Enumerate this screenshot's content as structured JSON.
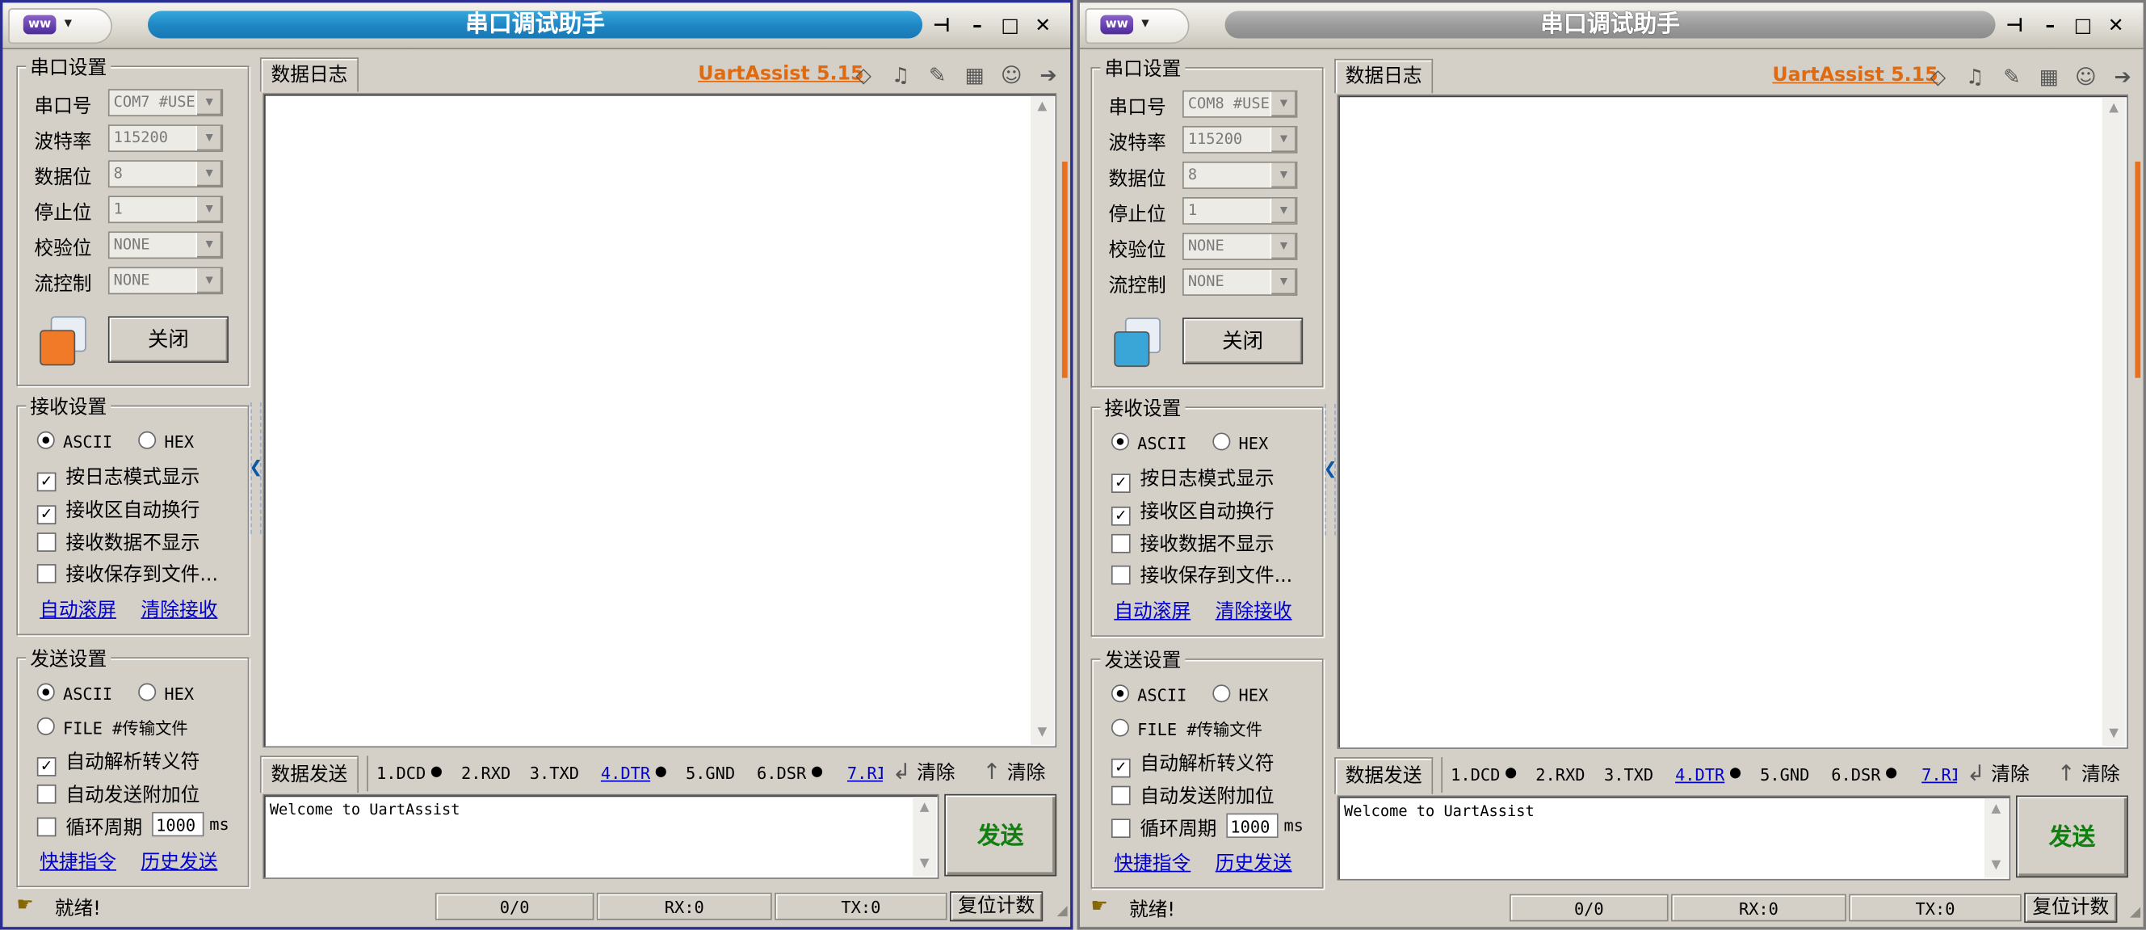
{
  "windows": [
    {
      "id": "left",
      "title": "串口调试助手",
      "serial": {
        "legend": "串口设置",
        "fields": [
          {
            "label": "串口号",
            "value": "COM7 #USE"
          },
          {
            "label": "波特率",
            "value": "115200"
          },
          {
            "label": "数据位",
            "value": "8"
          },
          {
            "label": "停止位",
            "value": "1"
          },
          {
            "label": "校验位",
            "value": "NONE"
          },
          {
            "label": "流控制",
            "value": "NONE"
          }
        ],
        "port_icon_color": "#f07a28",
        "open_close_label": "关闭"
      },
      "receive": {
        "legend": "接收设置",
        "ascii": "ASCII",
        "hex": "HEX",
        "options": [
          {
            "label": "按日志模式显示",
            "checked": true
          },
          {
            "label": "接收区自动换行",
            "checked": true
          },
          {
            "label": "接收数据不显示",
            "checked": false
          },
          {
            "label": "接收保存到文件...",
            "checked": false
          }
        ],
        "link_autoscroll": "自动滚屏",
        "link_clear": "清除接收"
      },
      "send": {
        "legend": "发送设置",
        "ascii": "ASCII",
        "hex": "HEX",
        "file": "FILE #传输文件",
        "options": [
          {
            "label": "自动解析转义符",
            "checked": true
          },
          {
            "label": "自动发送附加位",
            "checked": false
          }
        ],
        "cycle_label": "循环周期",
        "cycle_value": "1000",
        "cycle_unit": "ms",
        "link_shortcut": "快捷指令",
        "link_history": "历史发送"
      },
      "log_tab": "数据日志",
      "version": "UartAssist 5.15",
      "send_tab": "数据发送",
      "signals": [
        "1.DCD",
        "2.RXD",
        "3.TXD",
        "4.DTR",
        "5.GND",
        "6.DSR",
        "7.RI"
      ],
      "clear1": "清除",
      "clear2": "清除",
      "send_text": "Welcome to UartAssist",
      "send_button": "发送",
      "status": "就绪!",
      "counter": "0/0",
      "rx": "RX:0",
      "tx": "TX:0",
      "reset": "复位计数",
      "sysmenu_logo": "ww"
    },
    {
      "id": "right",
      "title": "串口调试助手",
      "serial": {
        "legend": "串口设置",
        "fields": [
          {
            "label": "串口号",
            "value": "COM8 #USE"
          },
          {
            "label": "波特率",
            "value": "115200"
          },
          {
            "label": "数据位",
            "value": "8"
          },
          {
            "label": "停止位",
            "value": "1"
          },
          {
            "label": "校验位",
            "value": "NONE"
          },
          {
            "label": "流控制",
            "value": "NONE"
          }
        ],
        "port_icon_color": "#3aa6d8",
        "open_close_label": "关闭"
      },
      "receive": {
        "legend": "接收设置",
        "ascii": "ASCII",
        "hex": "HEX",
        "options": [
          {
            "label": "按日志模式显示",
            "checked": true
          },
          {
            "label": "接收区自动换行",
            "checked": true
          },
          {
            "label": "接收数据不显示",
            "checked": false
          },
          {
            "label": "接收保存到文件...",
            "checked": false
          }
        ],
        "link_autoscroll": "自动滚屏",
        "link_clear": "清除接收"
      },
      "send": {
        "legend": "发送设置",
        "ascii": "ASCII",
        "hex": "HEX",
        "file": "FILE #传输文件",
        "options": [
          {
            "label": "自动解析转义符",
            "checked": true
          },
          {
            "label": "自动发送附加位",
            "checked": false
          }
        ],
        "cycle_label": "循环周期",
        "cycle_value": "1000",
        "cycle_unit": "ms",
        "link_shortcut": "快捷指令",
        "link_history": "历史发送"
      },
      "log_tab": "数据日志",
      "version": "UartAssist 5.15",
      "send_tab": "数据发送",
      "signals": [
        "1.DCD",
        "2.RXD",
        "3.TXD",
        "4.DTR",
        "5.GND",
        "6.DSR",
        "7.RI"
      ],
      "clear1": "清除",
      "clear2": "清除",
      "send_text": "Welcome to UartAssist",
      "send_button": "发送",
      "status": "就绪!",
      "counter": "0/0",
      "rx": "RX:0",
      "tx": "TX:0",
      "reset": "复位计数",
      "sysmenu_logo": "ww"
    }
  ]
}
